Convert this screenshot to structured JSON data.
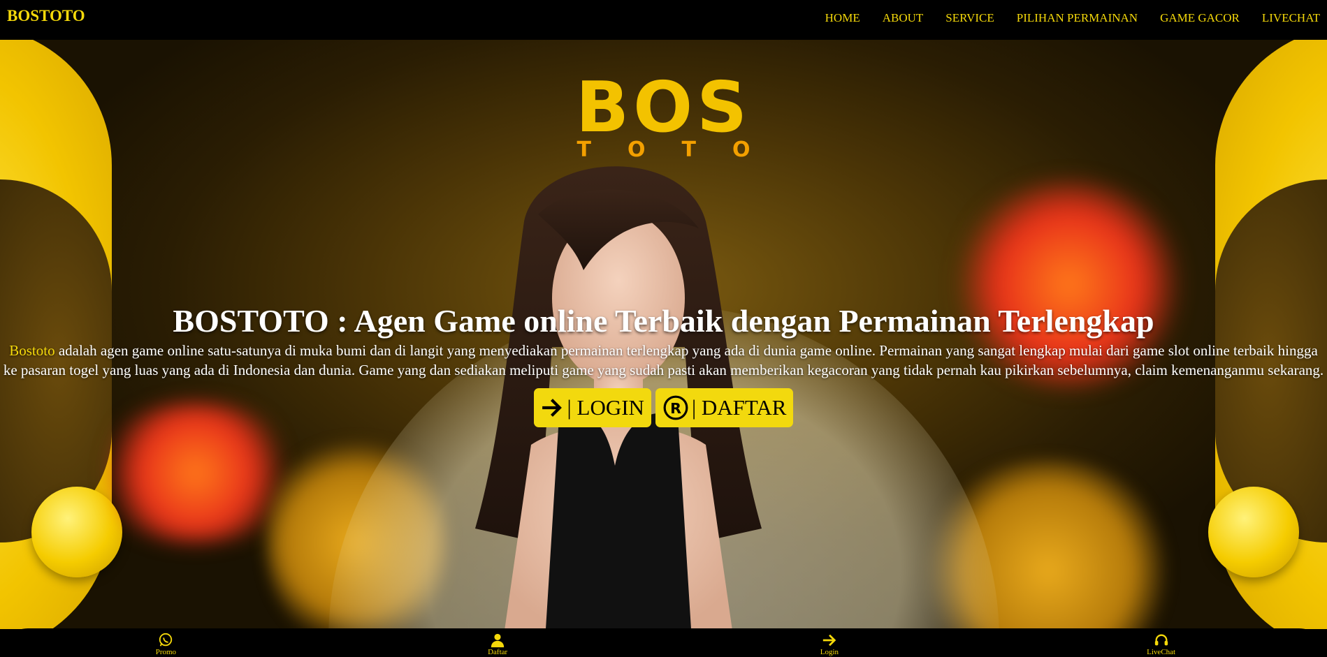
{
  "header": {
    "brand": "BOSTOTO",
    "nav": [
      "HOME",
      "ABOUT",
      "SERVICE",
      "PILIHAN PERMAINAN",
      "GAME GACOR",
      "LIVECHAT"
    ]
  },
  "hero": {
    "logo_main": "BOS",
    "logo_sub": "TOTO",
    "title": "BOSTOTO : Agen Game online Terbaik dengan Permainan Terlengkap",
    "desc_highlight": "Bostoto",
    "desc_rest": " adalah agen game online satu-satunya di muka bumi dan di langit yang menyediakan permainan terlengkap yang ada di dunia game online. Permainan yang sangat lengkap mulai dari game slot online terbaik hingga ke pasaran togel yang luas yang ada di Indonesia dan dunia. Game yang dan sediakan meliputi game yang sudah pasti akan memberikan kegacoran yang tidak pernah kau pikirkan sebelumnya, claim kemenanganmu sekarang.",
    "login_label": "| LOGIN",
    "daftar_label": "| DAFTAR"
  },
  "bottom_nav": [
    {
      "label": "Promo",
      "icon": "whatsapp-icon"
    },
    {
      "label": "Daftar",
      "icon": "user-icon"
    },
    {
      "label": "Login",
      "icon": "arrow-right-icon"
    },
    {
      "label": "LiveChat",
      "icon": "headset-icon"
    }
  ],
  "colors": {
    "accent": "#f5d90a",
    "background": "#000000",
    "button": "#f2d90e"
  }
}
